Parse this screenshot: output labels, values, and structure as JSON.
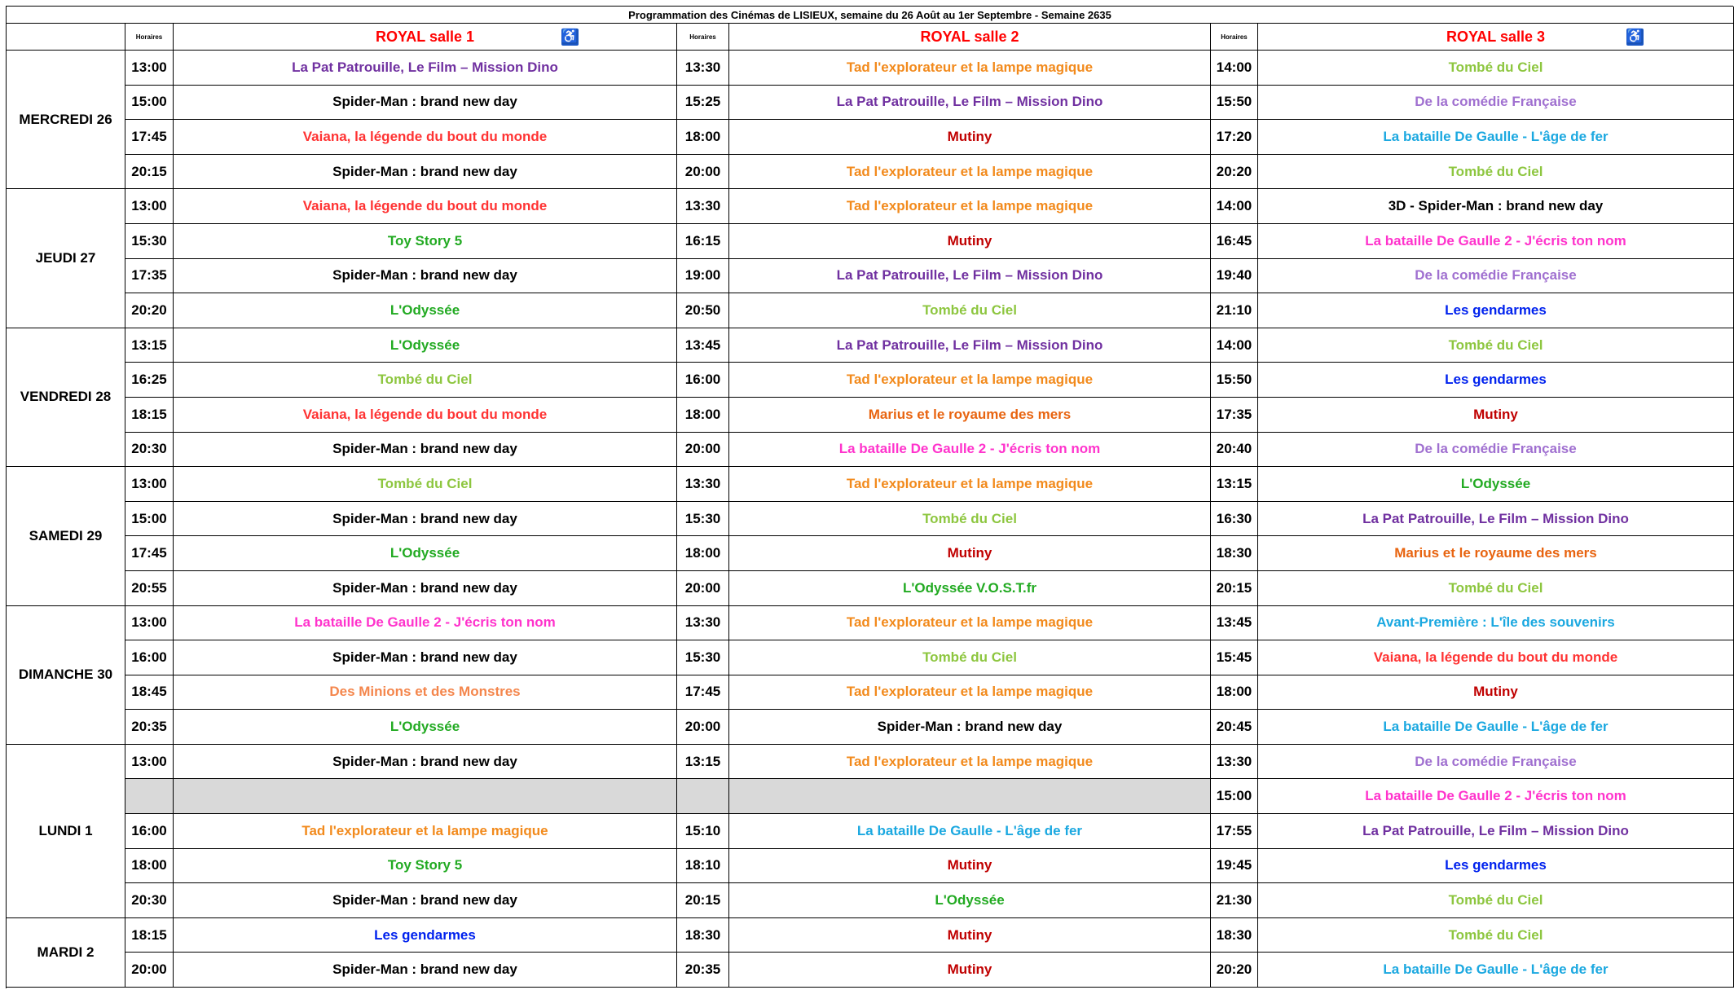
{
  "title": "Programmation des Cinémas de LISIEUX, semaine du 26 Août au 1er Septembre - Semaine 2635",
  "header": {
    "horaires_label": "Horaires",
    "halls": [
      "ROYAL salle 1",
      "ROYAL salle 2",
      "ROYAL salle 3"
    ],
    "accessible_icon": "wheelchair-icon",
    "accessible_halls": [
      1,
      3
    ]
  },
  "colors": {
    "purple": "#7030a0",
    "orange": "#f28a1c",
    "lightgreen": "#8dc63f",
    "black": "#000000",
    "red": "#ff3333",
    "darkred": "#c00000",
    "lavender": "#a070d0",
    "cyan": "#1ba8e0",
    "magenta": "#ff33cc",
    "green": "#22aa22",
    "blue": "#0022ee",
    "darkorange": "#e86410",
    "salmon": "#f4864c",
    "header_red": "#ff0000",
    "empty_fill": "#d9d9d9"
  },
  "days": [
    {
      "label": "MERCREDI 26",
      "rows": [
        [
          {
            "time": "13:00",
            "movie": "La Pat Patrouille, Le Film – Mission Dino",
            "color": "purple"
          },
          {
            "time": "13:30",
            "movie": "Tad l'explorateur et la lampe magique",
            "color": "orange"
          },
          {
            "time": "14:00",
            "movie": "Tombé du Ciel",
            "color": "lightgreen"
          }
        ],
        [
          {
            "time": "15:00",
            "movie": "Spider-Man : brand new day",
            "color": "black"
          },
          {
            "time": "15:25",
            "movie": "La Pat Patrouille, Le Film – Mission Dino",
            "color": "purple"
          },
          {
            "time": "15:50",
            "movie": "De la comédie Française",
            "color": "lavender"
          }
        ],
        [
          {
            "time": "17:45",
            "movie": "Vaiana, la légende du bout du monde",
            "color": "red"
          },
          {
            "time": "18:00",
            "movie": "Mutiny",
            "color": "darkred"
          },
          {
            "time": "17:20",
            "movie": "La bataille De Gaulle - L'âge de fer",
            "color": "cyan"
          }
        ],
        [
          {
            "time": "20:15",
            "movie": "Spider-Man : brand new day",
            "color": "black"
          },
          {
            "time": "20:00",
            "movie": "Tad l'explorateur et la lampe magique",
            "color": "orange"
          },
          {
            "time": "20:20",
            "movie": "Tombé du Ciel",
            "color": "lightgreen"
          }
        ]
      ]
    },
    {
      "label": "JEUDI 27",
      "rows": [
        [
          {
            "time": "13:00",
            "movie": "Vaiana, la légende du bout du monde",
            "color": "red"
          },
          {
            "time": "13:30",
            "movie": "Tad l'explorateur et la lampe magique",
            "color": "orange"
          },
          {
            "time": "14:00",
            "movie": "3D - Spider-Man : brand new day",
            "color": "black"
          }
        ],
        [
          {
            "time": "15:30",
            "movie": "Toy Story 5",
            "color": "green"
          },
          {
            "time": "16:15",
            "movie": "Mutiny",
            "color": "darkred"
          },
          {
            "time": "16:45",
            "movie": "La bataille De Gaulle 2 - J'écris ton nom",
            "color": "magenta"
          }
        ],
        [
          {
            "time": "17:35",
            "movie": "Spider-Man : brand new day",
            "color": "black"
          },
          {
            "time": "19:00",
            "movie": "La Pat Patrouille, Le Film – Mission Dino",
            "color": "purple"
          },
          {
            "time": "19:40",
            "movie": "De la comédie Française",
            "color": "lavender"
          }
        ],
        [
          {
            "time": "20:20",
            "movie": "L'Odyssée",
            "color": "green"
          },
          {
            "time": "20:50",
            "movie": "Tombé du Ciel",
            "color": "lightgreen"
          },
          {
            "time": "21:10",
            "movie": "Les gendarmes",
            "color": "blue"
          }
        ]
      ]
    },
    {
      "label": "VENDREDI 28",
      "rows": [
        [
          {
            "time": "13:15",
            "movie": "L'Odyssée",
            "color": "green"
          },
          {
            "time": "13:45",
            "movie": "La Pat Patrouille, Le Film – Mission Dino",
            "color": "purple"
          },
          {
            "time": "14:00",
            "movie": "Tombé du Ciel",
            "color": "lightgreen"
          }
        ],
        [
          {
            "time": "16:25",
            "movie": "Tombé du Ciel",
            "color": "lightgreen"
          },
          {
            "time": "16:00",
            "movie": "Tad l'explorateur et la lampe magique",
            "color": "orange"
          },
          {
            "time": "15:50",
            "movie": "Les gendarmes",
            "color": "blue"
          }
        ],
        [
          {
            "time": "18:15",
            "movie": "Vaiana, la légende du bout du monde",
            "color": "red"
          },
          {
            "time": "18:00",
            "movie": "Marius et le royaume des mers",
            "color": "darkorange"
          },
          {
            "time": "17:35",
            "movie": "Mutiny",
            "color": "darkred"
          }
        ],
        [
          {
            "time": "20:30",
            "movie": "Spider-Man : brand new day",
            "color": "black"
          },
          {
            "time": "20:00",
            "movie": "La bataille De Gaulle 2 - J'écris ton nom",
            "color": "magenta"
          },
          {
            "time": "20:40",
            "movie": "De la comédie Française",
            "color": "lavender"
          }
        ]
      ]
    },
    {
      "label": "SAMEDI 29",
      "rows": [
        [
          {
            "time": "13:00",
            "movie": "Tombé du Ciel",
            "color": "lightgreen"
          },
          {
            "time": "13:30",
            "movie": "Tad l'explorateur et la lampe magique",
            "color": "orange"
          },
          {
            "time": "13:15",
            "movie": "L'Odyssée",
            "color": "green"
          }
        ],
        [
          {
            "time": "15:00",
            "movie": "Spider-Man : brand new day",
            "color": "black"
          },
          {
            "time": "15:30",
            "movie": "Tombé du Ciel",
            "color": "lightgreen"
          },
          {
            "time": "16:30",
            "movie": "La Pat Patrouille, Le Film – Mission Dino",
            "color": "purple"
          }
        ],
        [
          {
            "time": "17:45",
            "movie": "L'Odyssée",
            "color": "green"
          },
          {
            "time": "18:00",
            "movie": "Mutiny",
            "color": "darkred"
          },
          {
            "time": "18:30",
            "movie": "Marius et le royaume des mers",
            "color": "darkorange"
          }
        ],
        [
          {
            "time": "20:55",
            "movie": "Spider-Man : brand new day",
            "color": "black"
          },
          {
            "time": "20:00",
            "movie": "L'Odyssée V.O.S.T.fr",
            "color": "green"
          },
          {
            "time": "20:15",
            "movie": "Tombé du Ciel",
            "color": "lightgreen"
          }
        ]
      ]
    },
    {
      "label": "DIMANCHE 30",
      "rows": [
        [
          {
            "time": "13:00",
            "movie": "La bataille De Gaulle 2 - J'écris ton nom",
            "color": "magenta"
          },
          {
            "time": "13:30",
            "movie": "Tad l'explorateur et la lampe magique",
            "color": "orange"
          },
          {
            "time": "13:45",
            "movie": "Avant-Première : L'île des souvenirs",
            "color": "cyan"
          }
        ],
        [
          {
            "time": "16:00",
            "movie": "Spider-Man : brand new day",
            "color": "black"
          },
          {
            "time": "15:30",
            "movie": "Tombé du Ciel",
            "color": "lightgreen"
          },
          {
            "time": "15:45",
            "movie": "Vaiana, la légende du bout du monde",
            "color": "red"
          }
        ],
        [
          {
            "time": "18:45",
            "movie": "Des Minions et des Monstres",
            "color": "salmon"
          },
          {
            "time": "17:45",
            "movie": "Tad l'explorateur et la lampe magique",
            "color": "orange"
          },
          {
            "time": "18:00",
            "movie": "Mutiny",
            "color": "darkred"
          }
        ],
        [
          {
            "time": "20:35",
            "movie": "L'Odyssée",
            "color": "green"
          },
          {
            "time": "20:00",
            "movie": "Spider-Man : brand new day",
            "color": "black"
          },
          {
            "time": "20:45",
            "movie": "La bataille De Gaulle - L'âge de fer",
            "color": "cyan"
          }
        ]
      ]
    },
    {
      "label": "LUNDI 1",
      "rows": [
        [
          {
            "time": "13:00",
            "movie": "Spider-Man : brand new day",
            "color": "black"
          },
          {
            "time": "13:15",
            "movie": "Tad l'explorateur et la lampe magique",
            "color": "orange"
          },
          {
            "time": "13:30",
            "movie": "De la comédie Française",
            "color": "lavender"
          }
        ],
        [
          null,
          null,
          {
            "time": "15:00",
            "movie": "La bataille De Gaulle 2 - J'écris ton nom",
            "color": "magenta"
          }
        ],
        [
          {
            "time": "16:00",
            "movie": "Tad l'explorateur et la lampe magique",
            "color": "orange"
          },
          {
            "time": "15:10",
            "movie": "La bataille De Gaulle - L'âge de fer",
            "color": "cyan"
          },
          {
            "time": "17:55",
            "movie": "La Pat Patrouille, Le Film – Mission Dino",
            "color": "purple"
          }
        ],
        [
          {
            "time": "18:00",
            "movie": "Toy Story 5",
            "color": "green"
          },
          {
            "time": "18:10",
            "movie": "Mutiny",
            "color": "darkred"
          },
          {
            "time": "19:45",
            "movie": "Les gendarmes",
            "color": "blue"
          }
        ],
        [
          {
            "time": "20:30",
            "movie": "Spider-Man : brand new day",
            "color": "black"
          },
          {
            "time": "20:15",
            "movie": "L'Odyssée",
            "color": "green"
          },
          {
            "time": "21:30",
            "movie": "Tombé du Ciel",
            "color": "lightgreen"
          }
        ]
      ]
    },
    {
      "label": "MARDI 2",
      "rows": [
        [
          {
            "time": "18:15",
            "movie": "Les gendarmes",
            "color": "blue"
          },
          {
            "time": "18:30",
            "movie": "Mutiny",
            "color": "darkred"
          },
          {
            "time": "18:30",
            "movie": "Tombé du Ciel",
            "color": "lightgreen"
          }
        ],
        [
          {
            "time": "20:00",
            "movie": "Spider-Man : brand new day",
            "color": "black"
          },
          {
            "time": "20:35",
            "movie": "Mutiny",
            "color": "darkred"
          },
          {
            "time": "20:20",
            "movie": "La bataille De Gaulle - L'âge de fer",
            "color": "cyan"
          }
        ]
      ]
    }
  ]
}
